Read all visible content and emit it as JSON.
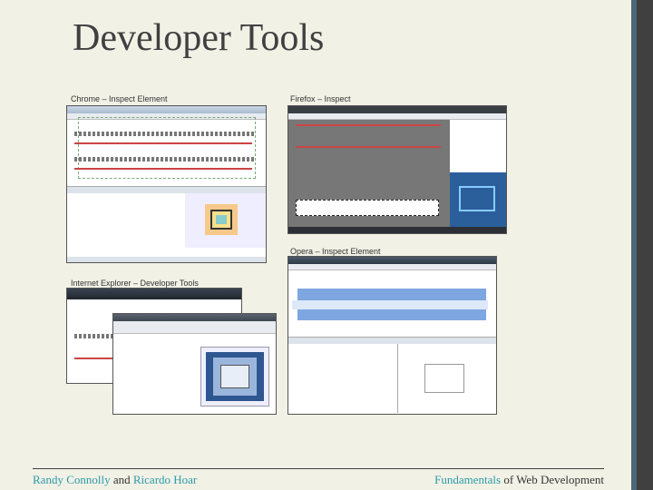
{
  "slide": {
    "title": "Developer Tools"
  },
  "screenshots": [
    {
      "caption": "Chrome – Inspect Element"
    },
    {
      "caption": "Firefox – Inspect"
    },
    {
      "caption": "Opera – Inspect Element"
    },
    {
      "caption": "Internet Explorer – Developer Tools"
    }
  ],
  "footer": {
    "author1": "Randy Connolly",
    "and": "and",
    "author2": "Ricardo Hoar",
    "book_highlight": "Fundamentals",
    "book_rest": "of Web Development"
  },
  "colors": {
    "background": "#f2f1e6",
    "accent": "#2a9aa8",
    "sidebar_blue": "#4a6878",
    "sidebar_dark": "#404040"
  }
}
